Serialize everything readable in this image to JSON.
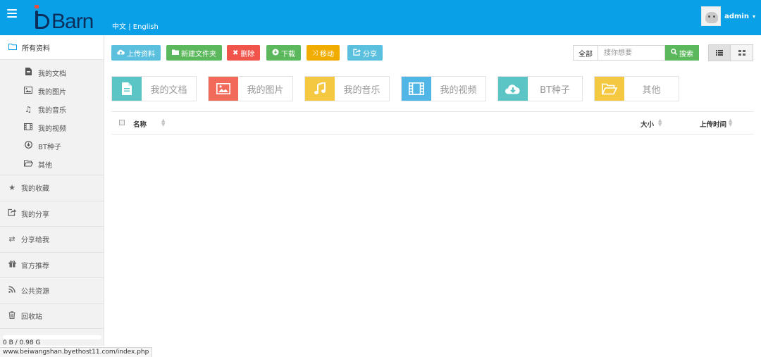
{
  "colors": {
    "topbar": "#0aa0e8",
    "upload": "#5bc0de",
    "new_folder": "#5cb85c",
    "delete": "#f0544a",
    "download": "#5cb85c",
    "move": "#f0ad00",
    "share": "#5bc0de",
    "search": "#5cb85c"
  },
  "header": {
    "logo_text": "Barn",
    "lang_zh": "中文",
    "lang_sep": "|",
    "lang_en": "English",
    "username": "admin",
    "caret": "▾"
  },
  "sidebar": {
    "all": "所有资料",
    "subitems": [
      {
        "label": "我的文档",
        "icon": "file-icon"
      },
      {
        "label": "我的图片",
        "icon": "picture-icon"
      },
      {
        "label": "我的音乐",
        "icon": "music-icon"
      },
      {
        "label": "我的视频",
        "icon": "film-icon"
      },
      {
        "label": "BT种子",
        "icon": "download-circle-icon"
      },
      {
        "label": "其他",
        "icon": "folder-open-icon"
      }
    ],
    "sections": [
      {
        "label": "我的收藏",
        "icon": "star-icon"
      },
      {
        "label": "我的分享",
        "icon": "share-icon"
      },
      {
        "label": "分享给我",
        "icon": "retweet-icon"
      },
      {
        "label": "官方推荐",
        "icon": "gift-icon"
      },
      {
        "label": "公共资源",
        "icon": "rss-icon"
      },
      {
        "label": "回收站",
        "icon": "trash-icon"
      }
    ],
    "storage_text": "0 B / 0.98 G",
    "storage_used_fraction": 0
  },
  "status_url": "www.beiwangshan.byethost11.com/index.php",
  "toolbar": {
    "upload": "上传资料",
    "new_folder": "新建文件夹",
    "delete": "删除",
    "download": "下载",
    "move": "移动",
    "share": "分享"
  },
  "search": {
    "scope": "全部",
    "placeholder": "搜你想要",
    "button": "搜索"
  },
  "categories": [
    {
      "label": "我的文档",
      "color": "#5bc4c4",
      "icon": "file-icon"
    },
    {
      "label": "我的图片",
      "color": "#f26a5a",
      "icon": "picture-icon"
    },
    {
      "label": "我的音乐",
      "color": "#f5c842",
      "icon": "music-icon"
    },
    {
      "label": "我的视频",
      "color": "#4fb6e6",
      "icon": "film-icon"
    },
    {
      "label": "BT种子",
      "color": "#5bc4c4",
      "icon": "cloud-download-icon"
    },
    {
      "label": "其他",
      "color": "#f5c842",
      "icon": "folder-open-icon"
    }
  ],
  "table": {
    "col_name": "名称",
    "col_size": "大小",
    "col_time": "上传时间"
  }
}
